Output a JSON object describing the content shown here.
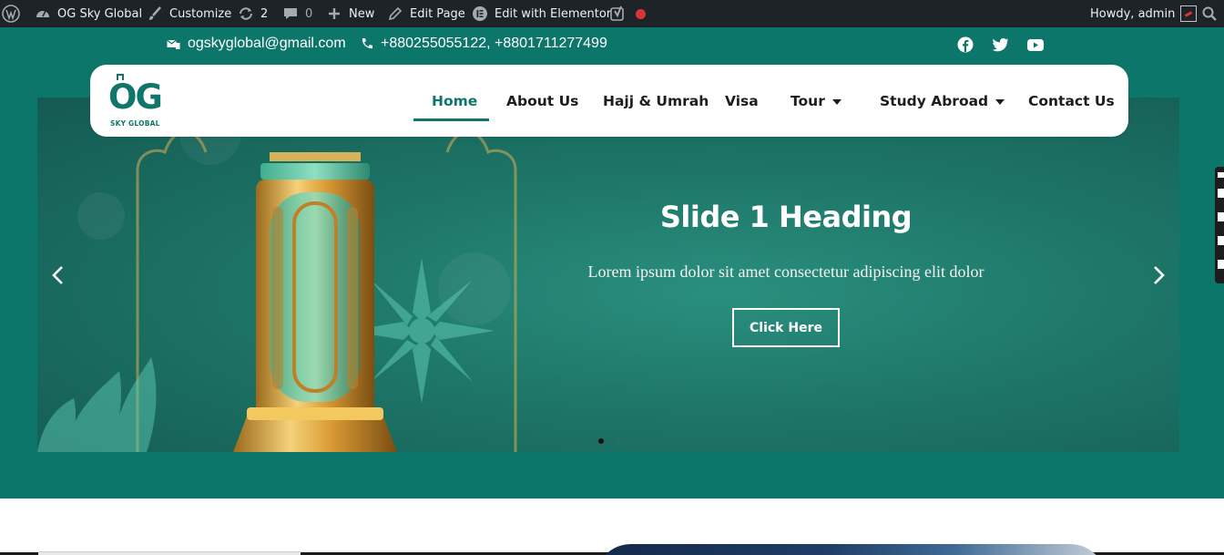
{
  "admin_bar": {
    "site_name": "OG Sky Global",
    "customize": "Customize",
    "updates_count": "2",
    "comments_count": "0",
    "new_label": "New",
    "edit_page": "Edit Page",
    "edit_elementor": "Edit with Elementor",
    "howdy": "Howdy, admin",
    "icons": [
      "wordpress-icon",
      "dashboard-icon",
      "brush-icon",
      "updates-icon",
      "comment-icon",
      "plus-icon",
      "pencil-icon",
      "elementor-icon",
      "yoast-icon",
      "record-dot-icon",
      "avatar",
      "search-icon"
    ]
  },
  "topbar": {
    "email": "ogskyglobal@gmail.com",
    "phone": "+880255055122, +8801711277499",
    "social": [
      "facebook-icon",
      "twitter-icon",
      "youtube-icon"
    ],
    "background": "#0d766a"
  },
  "header": {
    "logo_text": "OG",
    "logo_subtext": "SKY GLOBAL",
    "nav": [
      {
        "label": "Home",
        "active": true
      },
      {
        "label": "About Us"
      },
      {
        "label": "Hajj & Umrah"
      },
      {
        "label": "Visa"
      },
      {
        "label": "Tour",
        "dropdown": true
      },
      {
        "label": "Study Abroad",
        "dropdown": true
      },
      {
        "label": "Contact Us"
      }
    ],
    "accent": "#10756a"
  },
  "slider": {
    "heading": "Slide 1 Heading",
    "text": "Lorem ipsum dolor sit amet consectetur adipiscing elit dolor",
    "button": "Click Here",
    "slide_count": 2,
    "active_slide": 1,
    "colors": {
      "dot_active": "#111111",
      "dot_inactive": "#2d6b62"
    }
  }
}
